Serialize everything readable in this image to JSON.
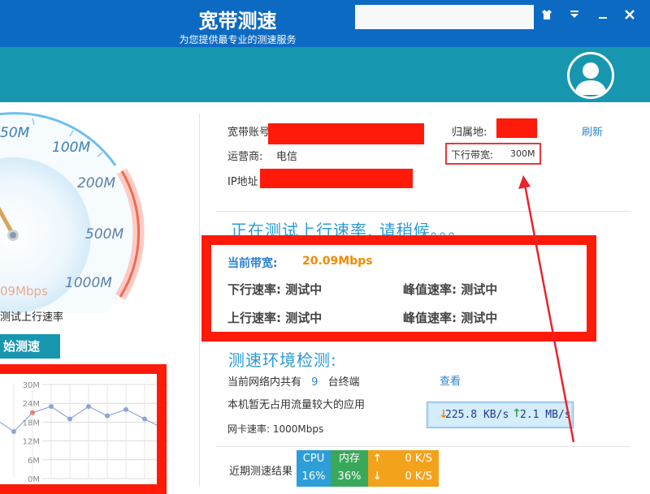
{
  "colors": {
    "titlebar": "#0c6ac3",
    "header": "#1796b0",
    "accent_blue": "#2b9ad6",
    "highlight_red": "#ff1a0a",
    "orange": "#f08c00"
  },
  "window": {
    "icons": [
      "shirt-skin-icon",
      "dropdown-menu-icon",
      "minimize-icon",
      "close-icon"
    ]
  },
  "header": {
    "title": "宽带测速",
    "subtitle": "为您提供最专业的测速服务",
    "avatar_icon": "user-avatar-icon"
  },
  "gauge": {
    "labels": [
      "50M",
      "100M",
      "200M",
      "500M",
      "1000M"
    ],
    "current_speed": "09Mbps",
    "status": "测试上行速率"
  },
  "start_button": "始测速",
  "mini_chart": {
    "chart_data": {
      "type": "line",
      "ylabels": [
        "30M",
        "24M",
        "18M",
        "12M",
        "6M",
        "0M"
      ],
      "ylim": [
        0,
        30
      ],
      "values": [
        19,
        15,
        21,
        23,
        19,
        23,
        20,
        22,
        19,
        16
      ]
    }
  },
  "account": {
    "account_label": "宽带账号",
    "location_label": "归属地:",
    "refresh": "刷新",
    "isp_label": "运营商:",
    "isp_value": "电信",
    "downband_label": "下行带宽:",
    "downband_value": "300M",
    "ip_label": "IP地址"
  },
  "testing": {
    "title": "正在测试上行速率, 请稍候。。。",
    "current_bw_label": "当前带宽:",
    "current_bw_value": "20.09Mbps",
    "down_rate": "下行速率: 测试中",
    "down_peak": "峰值速率: 测试中",
    "up_rate": "上行速率: 测试中",
    "up_peak": "峰值速率: 测试中"
  },
  "environment": {
    "title": "测速环境检测:",
    "devices_prefix": "当前网络内共有",
    "devices_count": "9",
    "devices_suffix": "台终端",
    "view_link": "查看",
    "traffic_note": "本机暂无占用流量较大的应用",
    "nic_speed": "网卡速率: 1000Mbps",
    "down_speed": "225.8 KB/s",
    "up_speed": "2.1 MB/s"
  },
  "recent": {
    "label": "近期测速结果"
  },
  "system": {
    "cpu_label": "CPU",
    "cpu_value": "16%",
    "mem_label": "内存",
    "mem_value": "36%",
    "up_rate": "0 K/S",
    "down_rate": "0 K/S"
  }
}
